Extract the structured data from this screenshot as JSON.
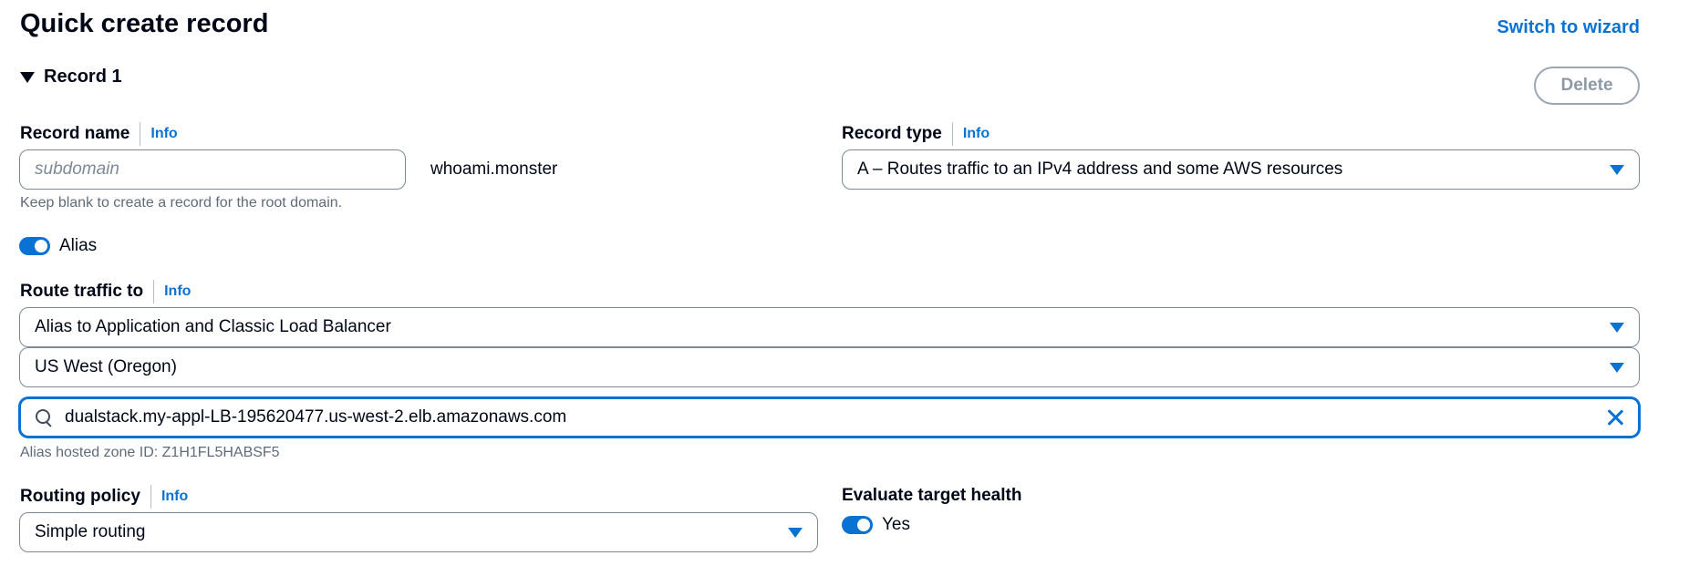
{
  "header": {
    "title": "Quick create record",
    "switch_wizard_label": "Switch to wizard"
  },
  "record": {
    "title": "Record 1",
    "delete_label": "Delete"
  },
  "record_name": {
    "label": "Record name",
    "info": "Info",
    "placeholder": "subdomain",
    "value": "",
    "domain_suffix": "whoami.monster",
    "hint": "Keep blank to create a record for the root domain."
  },
  "record_type": {
    "label": "Record type",
    "info": "Info",
    "value": "A – Routes traffic to an IPv4 address and some AWS resources"
  },
  "alias": {
    "label": "Alias",
    "enabled": true
  },
  "route_traffic": {
    "label": "Route traffic to",
    "info": "Info",
    "endpoint_type": "Alias to Application and Classic Load Balancer",
    "region": "US West (Oregon)",
    "load_balancer": "dualstack.my-appl-LB-195620477.us-west-2.elb.amazonaws.com",
    "hosted_zone_hint": "Alias hosted zone ID: Z1H1FL5HABSF5"
  },
  "routing_policy": {
    "label": "Routing policy",
    "info": "Info",
    "value": "Simple routing"
  },
  "evaluate_health": {
    "label": "Evaluate target health",
    "toggle_label": "Yes",
    "enabled": true
  },
  "colors": {
    "accent": "#0972d3",
    "text": "#000716",
    "muted": "#5f6b7a",
    "border": "#7d8998"
  }
}
